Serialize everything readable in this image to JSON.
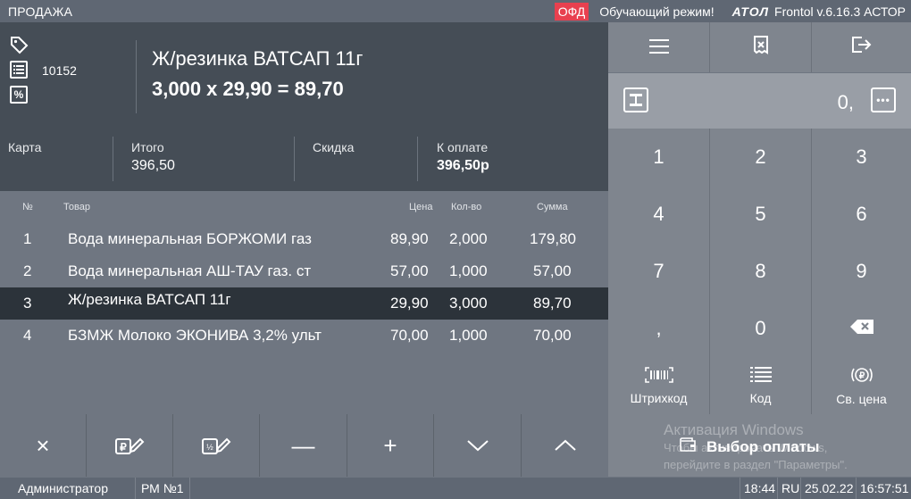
{
  "topbar": {
    "mode": "ПРОДАЖА",
    "ofd_badge": "ОФД",
    "training_mode": "Обучающий режим!",
    "vendor_logo": "АТОЛ",
    "version": "Frontol v.6.16.3 АСТОР",
    "ofd_color": "#e8404f"
  },
  "item": {
    "code": "10152",
    "name": "Ж/резинка ВАТСАП 11г",
    "calc": "3,000 x 29,90 = 89,70",
    "icons": [
      "tag-icon",
      "list-icon",
      "percent-icon"
    ]
  },
  "totals": {
    "card_label": "Карта",
    "total_label": "Итого",
    "total_value": "396,50",
    "discount_label": "Скидка",
    "payable_label": "К оплате",
    "payable_value": "396,50р"
  },
  "receipt": {
    "headers": {
      "num": "№",
      "product": "Товар",
      "price": "Цена",
      "qty": "Кол-во",
      "sum": "Сумма"
    },
    "rows": [
      {
        "num": "1",
        "name": "Вода минеральная БОРЖОМИ газ",
        "price": "89,90",
        "qty": "2,000",
        "sum": "179,80"
      },
      {
        "num": "2",
        "name": "Вода минеральная АШ-ТАУ газ. ст",
        "price": "57,00",
        "qty": "1,000",
        "sum": "57,00"
      },
      {
        "num": "3",
        "name": "Ж/резинка ВАТСАП 11г",
        "price": "29,90",
        "qty": "3,000",
        "sum": "89,70"
      },
      {
        "num": "4",
        "name": "БЗМЖ Молоко ЭКОНИВА 3,2% ульт",
        "price": "70,00",
        "qty": "1,000",
        "sum": "70,00"
      }
    ],
    "selected_row": 3
  },
  "toolbar": {
    "delete_icon": "×",
    "price_edit_icon": "price-edit-icon",
    "qty_edit_icon": "quantity-edit-icon",
    "minus": "—",
    "plus": "+",
    "down_icon": "chevron-down-icon",
    "up_icon": "chevron-up-icon"
  },
  "keypad": {
    "top_icons": [
      "menu-icon",
      "cancel-receipt-icon",
      "exit-icon"
    ],
    "display_value": "0,",
    "digits": [
      "1",
      "2",
      "3",
      "4",
      "5",
      "6",
      "7",
      "8",
      "9",
      ",",
      "0"
    ],
    "barcode_label": "Штрихкод",
    "code_label": "Код",
    "free_price_label": "Св. цена",
    "pay_label": "Выбор оплаты"
  },
  "watermark": {
    "line1": "Активация Windows",
    "line2": "Чтобы активировать Windows,",
    "line3": "перейдите в раздел \"Параметры\"."
  },
  "statusbar": {
    "user": "Администратор",
    "workplace": "РМ №1",
    "time": "18:44",
    "lang": "RU",
    "date": "25.02.22",
    "clock": "16:57:51"
  }
}
